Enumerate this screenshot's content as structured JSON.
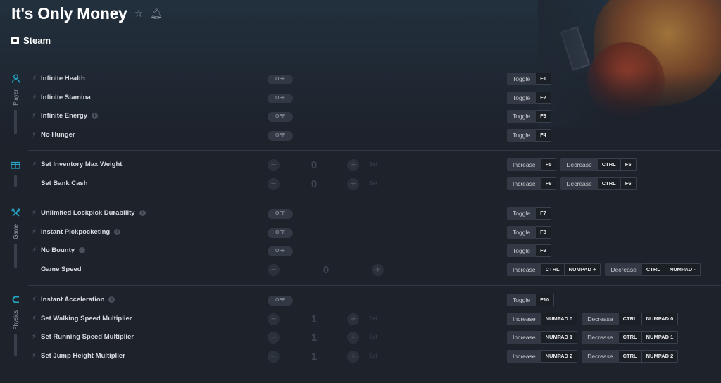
{
  "title": "It's Only Money",
  "platform": "Steam",
  "icons": {
    "favorite": "star-icon",
    "notify": "bell-icon",
    "mod": "bolt-icon",
    "info": "info-icon"
  },
  "colors": {
    "accent": "#25a6c4",
    "background": "#1d222b"
  },
  "categories": [
    {
      "label": "Player",
      "icon": "person-icon"
    },
    {
      "label": "",
      "icon": "gift-box-icon"
    },
    {
      "label": "Game",
      "icon": "crossed-tools-icon"
    },
    {
      "label": "Physics",
      "icon": "magnet-icon"
    }
  ],
  "toggle_off_label": "OFF",
  "minus_symbol": "−",
  "plus_symbol": "+",
  "set_label": "Set",
  "rows": {
    "infinite_health": {
      "name": "Infinite Health",
      "k1_label": "Toggle",
      "k1_key": "F1"
    },
    "infinite_stamina": {
      "name": "Infinite Stamina",
      "k1_label": "Toggle",
      "k1_key": "F2"
    },
    "infinite_energy": {
      "name": "Infinite Energy",
      "k1_label": "Toggle",
      "k1_key": "F3"
    },
    "no_hunger": {
      "name": "No Hunger",
      "k1_label": "Toggle",
      "k1_key": "F4"
    },
    "inventory_weight": {
      "name": "Set Inventory Max Weight",
      "value": "0",
      "k1_label": "Increase",
      "k1_key": "F5",
      "k2_label": "Decrease",
      "k2_mod": "CTRL",
      "k2_key": "F5"
    },
    "bank_cash": {
      "name": "Set Bank Cash",
      "value": "0",
      "k1_label": "Increase",
      "k1_key": "F6",
      "k2_label": "Decrease",
      "k2_mod": "CTRL",
      "k2_key": "F6"
    },
    "lockpick": {
      "name": "Unlimited Lockpick Durability",
      "k1_label": "Toggle",
      "k1_key": "F7"
    },
    "pickpocketing": {
      "name": "Instant Pickpocketing",
      "k1_label": "Toggle",
      "k1_key": "F8"
    },
    "no_bounty": {
      "name": "No Bounty",
      "k1_label": "Toggle",
      "k1_key": "F9"
    },
    "game_speed": {
      "name": "Game Speed",
      "value": "0",
      "k1_label": "Increase",
      "k1_mod": "CTRL",
      "k1_key": "NUMPAD +",
      "k2_label": "Decrease",
      "k2_mod": "CTRL",
      "k2_key": "NUMPAD -"
    },
    "instant_accel": {
      "name": "Instant Acceleration",
      "k1_label": "Toggle",
      "k1_key": "F10"
    },
    "walk_speed": {
      "name": "Set Walking Speed Multiplier",
      "value": "1",
      "k1_label": "Increase",
      "k1_key": "NUMPAD 0",
      "k2_label": "Decrease",
      "k2_mod": "CTRL",
      "k2_key": "NUMPAD 0"
    },
    "run_speed": {
      "name": "Set Running Speed Multiplier",
      "value": "1",
      "k1_label": "Increase",
      "k1_key": "NUMPAD 1",
      "k2_label": "Decrease",
      "k2_mod": "CTRL",
      "k2_key": "NUMPAD 1"
    },
    "jump_height": {
      "name": "Set Jump Height Multiplier",
      "value": "1",
      "k1_label": "Increase",
      "k1_key": "NUMPAD 2",
      "k2_label": "Decrease",
      "k2_mod": "CTRL",
      "k2_key": "NUMPAD 2"
    }
  }
}
